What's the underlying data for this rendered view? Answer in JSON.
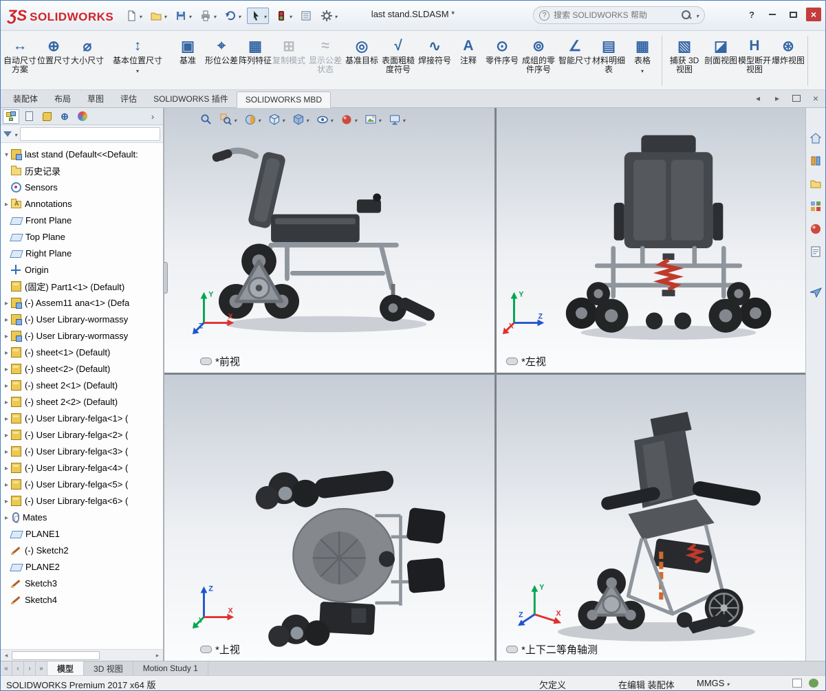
{
  "titlebar": {
    "logo_mark": "ƷS",
    "logo_text": "SOLIDWORKS",
    "document_title": "last stand.SLDASM *",
    "help_badge": "?",
    "help_label": "?",
    "search": {
      "placeholder": "搜索 SOLIDWORKS 帮助"
    }
  },
  "quick_toolbar": {
    "icons": [
      "new-document",
      "open",
      "save",
      "print",
      "undo",
      "select",
      "rebuild",
      "file-properties",
      "options"
    ]
  },
  "ribbon": {
    "items": [
      {
        "label": "自动尺寸方案",
        "icon": "↔",
        "enabled": true
      },
      {
        "label": "位置尺寸",
        "icon": "⊕",
        "enabled": true
      },
      {
        "label": "大小尺寸",
        "icon": "⌀",
        "enabled": true
      },
      {
        "label": "基本位置尺寸",
        "icon": "↕",
        "enabled": true
      },
      {
        "label": "基准",
        "icon": "▣",
        "enabled": true
      },
      {
        "label": "形位公差",
        "icon": "⌖",
        "enabled": true
      },
      {
        "label": "阵列特征",
        "icon": "▦",
        "enabled": true
      },
      {
        "label": "复制模式",
        "icon": "⊞",
        "enabled": false
      },
      {
        "label": "显示公差状态",
        "icon": "≈",
        "enabled": false
      },
      {
        "label": "基准目标",
        "icon": "◎",
        "enabled": true
      },
      {
        "label": "表面粗糙度符号",
        "icon": "√",
        "enabled": true
      },
      {
        "label": "焊接符号",
        "icon": "∿",
        "enabled": true
      },
      {
        "label": "注释",
        "icon": "A",
        "enabled": true
      },
      {
        "label": "零件序号",
        "icon": "⊙",
        "enabled": true
      },
      {
        "label": "成组的零件序号",
        "icon": "⊚",
        "enabled": true
      },
      {
        "label": "智能尺寸",
        "icon": "∠",
        "enabled": true
      },
      {
        "label": "材料明细表",
        "icon": "▤",
        "enabled": true
      },
      {
        "label": "表格",
        "icon": "▦",
        "enabled": true
      },
      {
        "label": "捕获 3D 视图",
        "icon": "▧",
        "enabled": true
      },
      {
        "label": "剖面视图",
        "icon": "◪",
        "enabled": true
      },
      {
        "label": "模型断开视图",
        "icon": "H",
        "enabled": true
      },
      {
        "label": "爆炸视图",
        "icon": "⊛",
        "enabled": true
      }
    ]
  },
  "command_tabs": {
    "items": [
      {
        "label": "装配体"
      },
      {
        "label": "布局"
      },
      {
        "label": "草图"
      },
      {
        "label": "评估"
      },
      {
        "label": "SOLIDWORKS 插件"
      },
      {
        "label": "SOLIDWORKS MBD"
      }
    ]
  },
  "feature_tree": {
    "root": "last stand (Default<<Default:",
    "items": [
      {
        "label": "历史记录"
      },
      {
        "label": "Sensors"
      },
      {
        "label": "Annotations"
      },
      {
        "label": "Front Plane"
      },
      {
        "label": "Top Plane"
      },
      {
        "label": "Right Plane"
      },
      {
        "label": "Origin"
      },
      {
        "label": "(固定) Part1<1> (Default)"
      },
      {
        "label": "(-) Assem11 ana<1> (Defa"
      },
      {
        "label": "(-) User Library-wormassy"
      },
      {
        "label": "(-) User Library-wormassy"
      },
      {
        "label": "(-) sheet<1> (Default)"
      },
      {
        "label": "(-) sheet<2> (Default)"
      },
      {
        "label": "(-) sheet 2<1> (Default)"
      },
      {
        "label": "(-) sheet 2<2> (Default)"
      },
      {
        "label": "(-) User Library-felga<1> ("
      },
      {
        "label": "(-) User Library-felga<2> ("
      },
      {
        "label": "(-) User Library-felga<3> ("
      },
      {
        "label": "(-) User Library-felga<4> ("
      },
      {
        "label": "(-) User Library-felga<5> ("
      },
      {
        "label": "(-) User Library-felga<6> ("
      },
      {
        "label": "Mates"
      },
      {
        "label": "PLANE1"
      },
      {
        "label": "(-) Sketch2"
      },
      {
        "label": "PLANE2"
      },
      {
        "label": "Sketch3"
      },
      {
        "label": "Sketch4"
      }
    ]
  },
  "hud": {
    "icons": [
      "zoom-fit",
      "zoom-area",
      "section-view",
      "view-orientation",
      "display-style",
      "hide-show",
      "edit-appearance",
      "apply-scene",
      "view-settings"
    ]
  },
  "viewport": {
    "views": [
      {
        "label": "*前视"
      },
      {
        "label": "*左视"
      },
      {
        "label": "*上视"
      },
      {
        "label": "*上下二等角轴测"
      }
    ],
    "triad": {
      "x": "X",
      "y": "Y",
      "z": "Z"
    }
  },
  "task_pane": {
    "icons": [
      "resources-home",
      "design-library",
      "file-explorer",
      "view-palette",
      "appearances",
      "custom-properties",
      "forum"
    ]
  },
  "bottom_tabs": {
    "items": [
      {
        "label": "模型"
      },
      {
        "label": "3D 视图"
      },
      {
        "label": "Motion Study 1"
      }
    ]
  },
  "statusbar": {
    "product": "SOLIDWORKS Premium 2017 x64 版",
    "definition_status": "欠定义",
    "editing_status": "在编辑 装配体",
    "units": "MMGS"
  },
  "colors": {
    "logo_red": "#d2232a",
    "close_button": "#c43c3c",
    "spring_red": "#c0392b",
    "strut_orange": "#d06a2c",
    "icon_blue": "#3465a4"
  }
}
